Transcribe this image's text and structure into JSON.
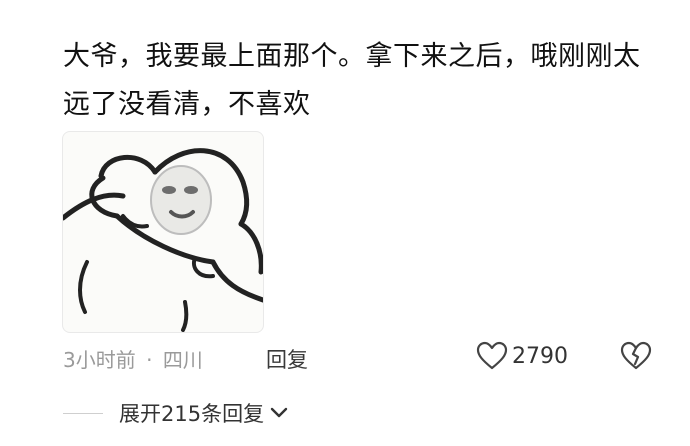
{
  "comment": {
    "text": "大爷，我要最上面那个。拿下来之后，哦刚刚太远了没看清，不喜欢",
    "image_alt": "sticker"
  },
  "meta": {
    "time": "3小时前",
    "separator": "·",
    "location": "四川",
    "reply_label": "回复"
  },
  "actions": {
    "like_icon": "heart-icon",
    "like_count": "2790",
    "dislike_icon": "broken-heart-icon"
  },
  "expand": {
    "label": "展开215条回复",
    "icon": "chevron-down-icon"
  }
}
